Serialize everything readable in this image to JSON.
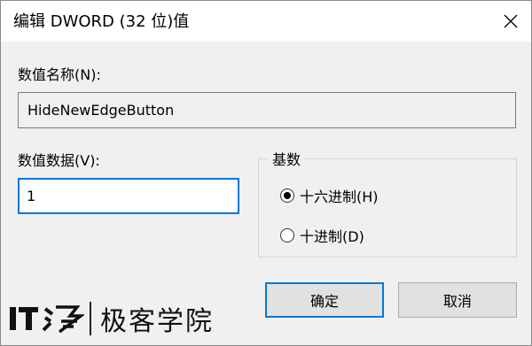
{
  "window": {
    "title": "编辑 DWORD (32 位)值"
  },
  "value_name": {
    "label": "数值名称(N):",
    "value": "HideNewEdgeButton"
  },
  "value_data": {
    "label": "数值数据(V):",
    "value": "1"
  },
  "base": {
    "title": "基数",
    "options": [
      {
        "label": "十六进制(H)",
        "selected": true
      },
      {
        "label": "十进制(D)",
        "selected": false
      }
    ]
  },
  "buttons": {
    "ok_label": "确定",
    "cancel_label": "取消"
  },
  "watermark": {
    "text": "极客学院"
  },
  "colors": {
    "accent": "#0078d7",
    "dialog_bg": "#f0f0f0",
    "titlebar_bg": "#ffffff"
  },
  "icons": {
    "close": "close-icon",
    "logo": "ithome-logo"
  }
}
